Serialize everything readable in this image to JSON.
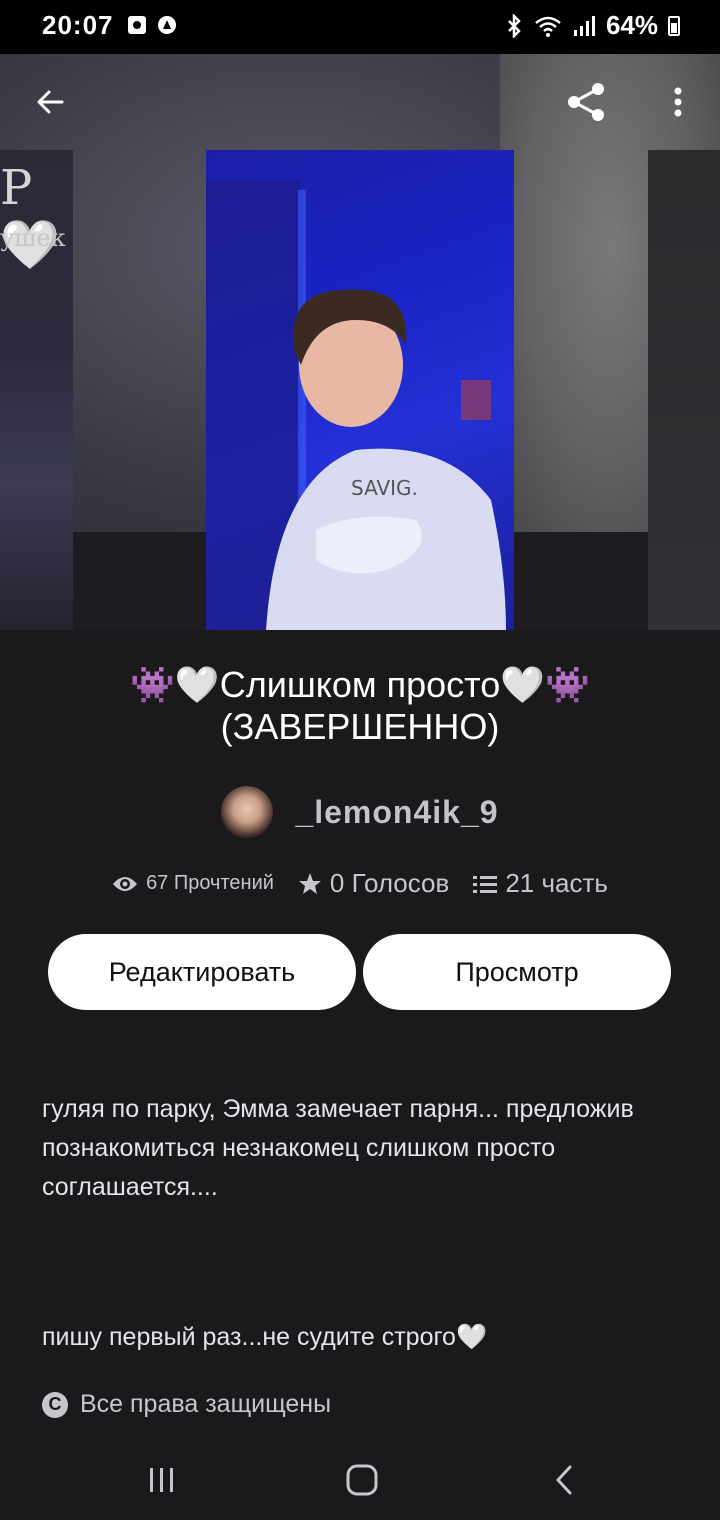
{
  "status_bar": {
    "time": "20:07",
    "battery": "64%",
    "icons": [
      "photo-notification-icon",
      "vpn-icon",
      "bluetooth-icon",
      "wifi-icon",
      "signal-icon",
      "battery-icon"
    ]
  },
  "header": {
    "back_icon": "arrow-left-icon",
    "share_icon": "share-icon",
    "more_icon": "more-vertical-icon"
  },
  "side_card": {
    "left_text_1": "Р🤍",
    "left_text_2": "ушек"
  },
  "story": {
    "title": "👾🤍Слишком просто🤍👾 (ЗАВЕРШЕННО)",
    "author": "_lemon4ik_9",
    "stats": {
      "reads": "67 Прочтений",
      "votes": "0 Голосов",
      "parts": "21 часть"
    },
    "description_1": "гуляя по парку, Эмма замечает парня... предложив познакомиться незнакомец слишком просто соглашается....",
    "description_2": "пишу первый раз...не судите строго🤍",
    "rights": "Все права защищены"
  },
  "buttons": {
    "edit": "Редактировать",
    "view": "Просмотр"
  },
  "colors": {
    "background": "#1b191c",
    "button_bg": "#ffffff",
    "cover_blue": "#1a24c6"
  }
}
